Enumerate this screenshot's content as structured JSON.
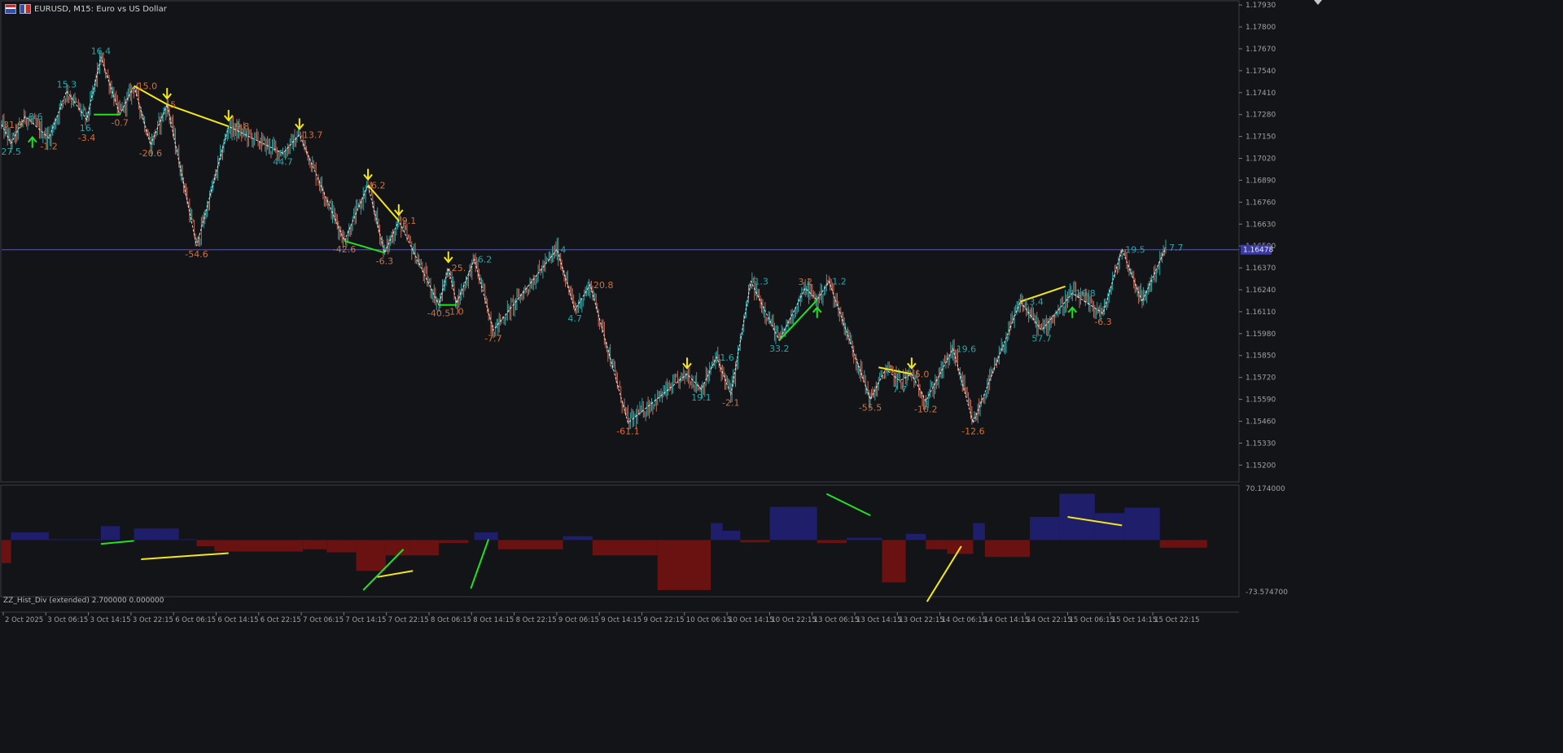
{
  "header": {
    "title": "EURUSD, M15:  Euro vs US Dollar"
  },
  "subwindow": {
    "title": "ZZ_Hist_Div (extended) 2.700000 0.000000"
  },
  "colors": {
    "background": "#131418",
    "bull_candle": "#26a6a6",
    "bear_candle": "#c06a58",
    "zigzag": "#ffffff",
    "div_bull": "#22e022",
    "div_bear": "#f4e619",
    "arrow_up": "#22e022",
    "arrow_down": "#f4e619",
    "label_low": "#d0703a",
    "label_high": "#26a6a6",
    "price_line": "#5a5aaa",
    "hist_pos": "#1e1e6a",
    "hist_neg": "#6a1212",
    "axis_text": "#a0a0a0"
  },
  "chart_data": [
    {
      "type": "candlestick",
      "title": "EURUSD, M15:  Euro vs US Dollar",
      "ylim": [
        1.151,
        1.1795
      ],
      "y_ticks": [
        "1.17930",
        "1.17800",
        "1.17670",
        "1.17540",
        "1.17410",
        "1.17280",
        "1.17150",
        "1.17020",
        "1.16890",
        "1.16760",
        "1.16630",
        "1.16500",
        "1.16370",
        "1.16240",
        "1.16110",
        "1.15980",
        "1.15850",
        "1.15720",
        "1.15590",
        "1.15460",
        "1.15330",
        "1.15200"
      ],
      "x_ticks": [
        "2 Oct 2025",
        "3 Oct 06:15",
        "3 Oct 14:15",
        "3 Oct 22:15",
        "6 Oct 06:15",
        "6 Oct 14:15",
        "6 Oct 22:15",
        "7 Oct 06:15",
        "7 Oct 14:15",
        "7 Oct 22:15",
        "8 Oct 06:15",
        "8 Oct 14:15",
        "8 Oct 22:15",
        "9 Oct 06:15",
        "9 Oct 14:15",
        "9 Oct 22:15",
        "10 Oct 06:15",
        "10 Oct 14:15",
        "10 Oct 22:15",
        "13 Oct 06:15",
        "13 Oct 14:15",
        "13 Oct 22:15",
        "14 Oct 06:15",
        "14 Oct 14:15",
        "14 Oct 22:15",
        "15 Oct 06:15",
        "15 Oct 14:15",
        "15 Oct 22:15"
      ],
      "current_price": "1.16478",
      "zigzag": [
        {
          "i": 0,
          "p": 1.1722
        },
        {
          "i": 8,
          "p": 1.1711
        },
        {
          "i": 20,
          "p": 1.1727
        },
        {
          "i": 40,
          "p": 1.1714
        },
        {
          "i": 55,
          "p": 1.1742
        },
        {
          "i": 72,
          "p": 1.1725
        },
        {
          "i": 84,
          "p": 1.1762
        },
        {
          "i": 100,
          "p": 1.1728
        },
        {
          "i": 112,
          "p": 1.1745
        },
        {
          "i": 126,
          "p": 1.171
        },
        {
          "i": 140,
          "p": 1.1734
        },
        {
          "i": 165,
          "p": 1.165
        },
        {
          "i": 192,
          "p": 1.1721
        },
        {
          "i": 238,
          "p": 1.1705
        },
        {
          "i": 252,
          "p": 1.1716
        },
        {
          "i": 290,
          "p": 1.1653
        },
        {
          "i": 310,
          "p": 1.1686
        },
        {
          "i": 324,
          "p": 1.1646
        },
        {
          "i": 336,
          "p": 1.1665
        },
        {
          "i": 370,
          "p": 1.1615
        },
        {
          "i": 378,
          "p": 1.1637
        },
        {
          "i": 385,
          "p": 1.1616
        },
        {
          "i": 400,
          "p": 1.1642
        },
        {
          "i": 416,
          "p": 1.16
        },
        {
          "i": 470,
          "p": 1.1648
        },
        {
          "i": 485,
          "p": 1.1612
        },
        {
          "i": 498,
          "p": 1.1627
        },
        {
          "i": 530,
          "p": 1.1545
        },
        {
          "i": 580,
          "p": 1.1574
        },
        {
          "i": 592,
          "p": 1.1565
        },
        {
          "i": 605,
          "p": 1.1584
        },
        {
          "i": 617,
          "p": 1.1562
        },
        {
          "i": 634,
          "p": 1.1629
        },
        {
          "i": 658,
          "p": 1.1594
        },
        {
          "i": 680,
          "p": 1.1625
        },
        {
          "i": 690,
          "p": 1.1618
        },
        {
          "i": 700,
          "p": 1.1629
        },
        {
          "i": 735,
          "p": 1.1559
        },
        {
          "i": 748,
          "p": 1.1577
        },
        {
          "i": 760,
          "p": 1.157
        },
        {
          "i": 770,
          "p": 1.1574
        },
        {
          "i": 782,
          "p": 1.1558
        },
        {
          "i": 805,
          "p": 1.1589
        },
        {
          "i": 822,
          "p": 1.1545
        },
        {
          "i": 862,
          "p": 1.1617
        },
        {
          "i": 880,
          "p": 1.16
        },
        {
          "i": 906,
          "p": 1.1622
        },
        {
          "i": 932,
          "p": 1.161
        },
        {
          "i": 948,
          "p": 1.1648
        },
        {
          "i": 965,
          "p": 1.1617
        },
        {
          "i": 985,
          "p": 1.1649
        }
      ],
      "labels": [
        {
          "i": 0,
          "p": 1.1722,
          "text": "31.9",
          "kind": "low",
          "pos": "left"
        },
        {
          "i": 8,
          "p": 1.1711,
          "text": "27.5",
          "kind": "high",
          "pos": "below"
        },
        {
          "i": 20,
          "p": 1.1727,
          "text": "3.6",
          "kind": "high",
          "pos": "right"
        },
        {
          "i": 40,
          "p": 1.1714,
          "text": "-1.2",
          "kind": "low",
          "pos": "below"
        },
        {
          "i": 55,
          "p": 1.1742,
          "text": "15.3",
          "kind": "high",
          "pos": "above"
        },
        {
          "i": 72,
          "p": 1.1725,
          "text": "16.",
          "kind": "high",
          "pos": "below"
        },
        {
          "i": 72,
          "p": 1.1725,
          "text": "-3.4",
          "kind": "low",
          "pos": "below2"
        },
        {
          "i": 84,
          "p": 1.1762,
          "text": "16.4",
          "kind": "high",
          "pos": "above"
        },
        {
          "i": 100,
          "p": 1.1728,
          "text": "-0.7",
          "kind": "low",
          "pos": "below"
        },
        {
          "i": 112,
          "p": 1.1745,
          "text": "15.0",
          "kind": "low",
          "pos": "right"
        },
        {
          "i": 126,
          "p": 1.171,
          "text": "-20.6",
          "kind": "low",
          "pos": "below"
        },
        {
          "i": 140,
          "p": 1.1734,
          "text": "5",
          "kind": "low",
          "pos": "right"
        },
        {
          "i": 165,
          "p": 1.165,
          "text": "-54.6",
          "kind": "low",
          "pos": "below"
        },
        {
          "i": 192,
          "p": 1.1721,
          "text": "-9.8",
          "kind": "low",
          "pos": "right"
        },
        {
          "i": 238,
          "p": 1.1705,
          "text": "44.7",
          "kind": "high",
          "pos": "below"
        },
        {
          "i": 252,
          "p": 1.1716,
          "text": "13.7",
          "kind": "low",
          "pos": "right"
        },
        {
          "i": 290,
          "p": 1.1653,
          "text": "-42.6",
          "kind": "low",
          "pos": "below"
        },
        {
          "i": 310,
          "p": 1.1686,
          "text": "6.2",
          "kind": "low",
          "pos": "right"
        },
        {
          "i": 324,
          "p": 1.1646,
          "text": "-6.3",
          "kind": "low",
          "pos": "below"
        },
        {
          "i": 336,
          "p": 1.1665,
          "text": "9.1",
          "kind": "low",
          "pos": "right"
        },
        {
          "i": 370,
          "p": 1.1615,
          "text": "-40.5",
          "kind": "low",
          "pos": "below"
        },
        {
          "i": 378,
          "p": 1.1637,
          "text": "25.",
          "kind": "low",
          "pos": "right"
        },
        {
          "i": 385,
          "p": 1.1616,
          "text": "1.0",
          "kind": "low",
          "pos": "below"
        },
        {
          "i": 400,
          "p": 1.1642,
          "text": "6.2",
          "kind": "high",
          "pos": "right"
        },
        {
          "i": 416,
          "p": 1.16,
          "text": "-7.7",
          "kind": "low",
          "pos": "below"
        },
        {
          "i": 470,
          "p": 1.1648,
          "text": "4",
          "kind": "high",
          "pos": "right"
        },
        {
          "i": 485,
          "p": 1.1612,
          "text": "4.7",
          "kind": "high",
          "pos": "below"
        },
        {
          "i": 498,
          "p": 1.1627,
          "text": "20.8",
          "kind": "low",
          "pos": "right"
        },
        {
          "i": 530,
          "p": 1.1545,
          "text": "-61.1",
          "kind": "low",
          "pos": "below"
        },
        {
          "i": 592,
          "p": 1.1565,
          "text": "19.1",
          "kind": "high",
          "pos": "below"
        },
        {
          "i": 605,
          "p": 1.1584,
          "text": "1.6",
          "kind": "high",
          "pos": "right"
        },
        {
          "i": 617,
          "p": 1.1562,
          "text": "-2.1",
          "kind": "low",
          "pos": "below"
        },
        {
          "i": 634,
          "p": 1.1629,
          "text": "1.3",
          "kind": "high",
          "pos": "right"
        },
        {
          "i": 658,
          "p": 1.1594,
          "text": "33.2",
          "kind": "high",
          "pos": "below"
        },
        {
          "i": 680,
          "p": 1.1625,
          "text": "3.2",
          "kind": "low",
          "pos": "above"
        },
        {
          "i": 700,
          "p": 1.1629,
          "text": "1.2",
          "kind": "high",
          "pos": "right"
        },
        {
          "i": 735,
          "p": 1.1559,
          "text": "-55.5",
          "kind": "low",
          "pos": "below"
        },
        {
          "i": 748,
          "p": 1.1577,
          "text": "3",
          "kind": "low",
          "pos": "right"
        },
        {
          "i": 760,
          "p": 1.157,
          "text": "7.7",
          "kind": "high",
          "pos": "below"
        },
        {
          "i": 770,
          "p": 1.1574,
          "text": "5.0",
          "kind": "low",
          "pos": "right"
        },
        {
          "i": 782,
          "p": 1.1558,
          "text": "-10.2",
          "kind": "low",
          "pos": "below"
        },
        {
          "i": 805,
          "p": 1.1589,
          "text": "19.6",
          "kind": "high",
          "pos": "right"
        },
        {
          "i": 822,
          "p": 1.1545,
          "text": "-12.6",
          "kind": "low",
          "pos": "below"
        },
        {
          "i": 862,
          "p": 1.1617,
          "text": "13.4",
          "kind": "high",
          "pos": "right"
        },
        {
          "i": 880,
          "p": 1.16,
          "text": "57.7",
          "kind": "high",
          "pos": "below"
        },
        {
          "i": 906,
          "p": 1.1622,
          "text": "16.8",
          "kind": "high",
          "pos": "right"
        },
        {
          "i": 932,
          "p": 1.161,
          "text": "-6.3",
          "kind": "low",
          "pos": "below"
        },
        {
          "i": 948,
          "p": 1.1648,
          "text": "19.5",
          "kind": "high",
          "pos": "right"
        },
        {
          "i": 985,
          "p": 1.1649,
          "text": "7.7",
          "kind": "high",
          "pos": "right"
        }
      ],
      "arrows": [
        {
          "i": 26,
          "p": 1.1715,
          "dir": "up"
        },
        {
          "i": 140,
          "p": 1.1737,
          "dir": "down"
        },
        {
          "i": 192,
          "p": 1.1724,
          "dir": "down"
        },
        {
          "i": 252,
          "p": 1.1719,
          "dir": "down"
        },
        {
          "i": 310,
          "p": 1.1689,
          "dir": "down"
        },
        {
          "i": 336,
          "p": 1.1668,
          "dir": "down"
        },
        {
          "i": 378,
          "p": 1.164,
          "dir": "down"
        },
        {
          "i": 580,
          "p": 1.1577,
          "dir": "down"
        },
        {
          "i": 690,
          "p": 1.1614,
          "dir": "up"
        },
        {
          "i": 770,
          "p": 1.1577,
          "dir": "down"
        },
        {
          "i": 906,
          "p": 1.1614,
          "dir": "up"
        }
      ],
      "divergence_lines": [
        {
          "i1": 78,
          "p1": 1.1728,
          "i2": 100,
          "p2": 1.1728,
          "kind": "bull"
        },
        {
          "i1": 112,
          "p1": 1.1745,
          "i2": 140,
          "p2": 1.1734,
          "kind": "bear"
        },
        {
          "i1": 140,
          "p1": 1.1734,
          "i2": 192,
          "p2": 1.1721,
          "kind": "bear"
        },
        {
          "i1": 290,
          "p1": 1.1653,
          "i2": 324,
          "p2": 1.1646,
          "kind": "bull"
        },
        {
          "i1": 310,
          "p1": 1.1686,
          "i2": 336,
          "p2": 1.1665,
          "kind": "bear"
        },
        {
          "i1": 370,
          "p1": 1.1615,
          "i2": 385,
          "p2": 1.1615,
          "kind": "bull"
        },
        {
          "i1": 658,
          "p1": 1.1594,
          "i2": 690,
          "p2": 1.1618,
          "kind": "bull"
        },
        {
          "i1": 742,
          "p1": 1.1578,
          "i2": 770,
          "p2": 1.1574,
          "kind": "bear"
        },
        {
          "i1": 862,
          "p1": 1.1617,
          "i2": 900,
          "p2": 1.1626,
          "kind": "bear"
        }
      ]
    },
    {
      "type": "bar",
      "title": "ZZ_Hist_Div (extended) 2.700000 0.000000",
      "ylim": [
        -73.5747,
        70.174
      ],
      "y_ticks": [
        "70.174000",
        "-73.574700"
      ],
      "blocks": [
        {
          "i1": 0,
          "i2": 8,
          "v": -30
        },
        {
          "i1": 8,
          "i2": 40,
          "v": 10
        },
        {
          "i1": 40,
          "i2": 84,
          "v": 1
        },
        {
          "i1": 84,
          "i2": 100,
          "v": 18
        },
        {
          "i1": 112,
          "i2": 150,
          "v": 15
        },
        {
          "i1": 150,
          "i2": 165,
          "v": 1
        },
        {
          "i1": 165,
          "i2": 180,
          "v": -8
        },
        {
          "i1": 180,
          "i2": 255,
          "v": -15
        },
        {
          "i1": 255,
          "i2": 275,
          "v": -12
        },
        {
          "i1": 275,
          "i2": 300,
          "v": -16
        },
        {
          "i1": 300,
          "i2": 325,
          "v": -40
        },
        {
          "i1": 325,
          "i2": 345,
          "v": -20
        },
        {
          "i1": 345,
          "i2": 370,
          "v": -20
        },
        {
          "i1": 370,
          "i2": 395,
          "v": -4
        },
        {
          "i1": 400,
          "i2": 420,
          "v": 10
        },
        {
          "i1": 420,
          "i2": 475,
          "v": -12
        },
        {
          "i1": 475,
          "i2": 500,
          "v": 5
        },
        {
          "i1": 500,
          "i2": 555,
          "v": -20
        },
        {
          "i1": 555,
          "i2": 600,
          "v": -65
        },
        {
          "i1": 600,
          "i2": 610,
          "v": 22
        },
        {
          "i1": 610,
          "i2": 625,
          "v": 12
        },
        {
          "i1": 625,
          "i2": 650,
          "v": -3
        },
        {
          "i1": 650,
          "i2": 690,
          "v": 43
        },
        {
          "i1": 690,
          "i2": 715,
          "v": -4
        },
        {
          "i1": 715,
          "i2": 745,
          "v": 3
        },
        {
          "i1": 745,
          "i2": 765,
          "v": -55
        },
        {
          "i1": 765,
          "i2": 782,
          "v": 8
        },
        {
          "i1": 782,
          "i2": 800,
          "v": -12
        },
        {
          "i1": 800,
          "i2": 822,
          "v": -18
        },
        {
          "i1": 822,
          "i2": 832,
          "v": 22
        },
        {
          "i1": 832,
          "i2": 870,
          "v": -22
        },
        {
          "i1": 870,
          "i2": 895,
          "v": 30
        },
        {
          "i1": 895,
          "i2": 925,
          "v": 60
        },
        {
          "i1": 925,
          "i2": 950,
          "v": 35
        },
        {
          "i1": 950,
          "i2": 980,
          "v": 42
        },
        {
          "i1": 980,
          "i2": 1020,
          "v": -10
        }
      ],
      "div_lines": [
        {
          "i1": 84,
          "v1": -5,
          "i2": 112,
          "v2": -1,
          "kind": "bull"
        },
        {
          "i1": 118,
          "v1": -25,
          "i2": 192,
          "v2": -17,
          "kind": "bear"
        },
        {
          "i1": 306,
          "v1": -65,
          "i2": 340,
          "v2": -12,
          "kind": "bull"
        },
        {
          "i1": 318,
          "v1": -48,
          "i2": 348,
          "v2": -40,
          "kind": "bear"
        },
        {
          "i1": 397,
          "v1": -63,
          "i2": 412,
          "v2": 1,
          "kind": "bull"
        },
        {
          "i1": 698,
          "v1": 60,
          "i2": 735,
          "v2": 32,
          "kind": "bull"
        },
        {
          "i1": 783,
          "v1": -80,
          "i2": 812,
          "v2": -8,
          "kind": "bear"
        },
        {
          "i1": 902,
          "v1": 30,
          "i2": 948,
          "v2": 19,
          "kind": "bear"
        }
      ]
    }
  ]
}
